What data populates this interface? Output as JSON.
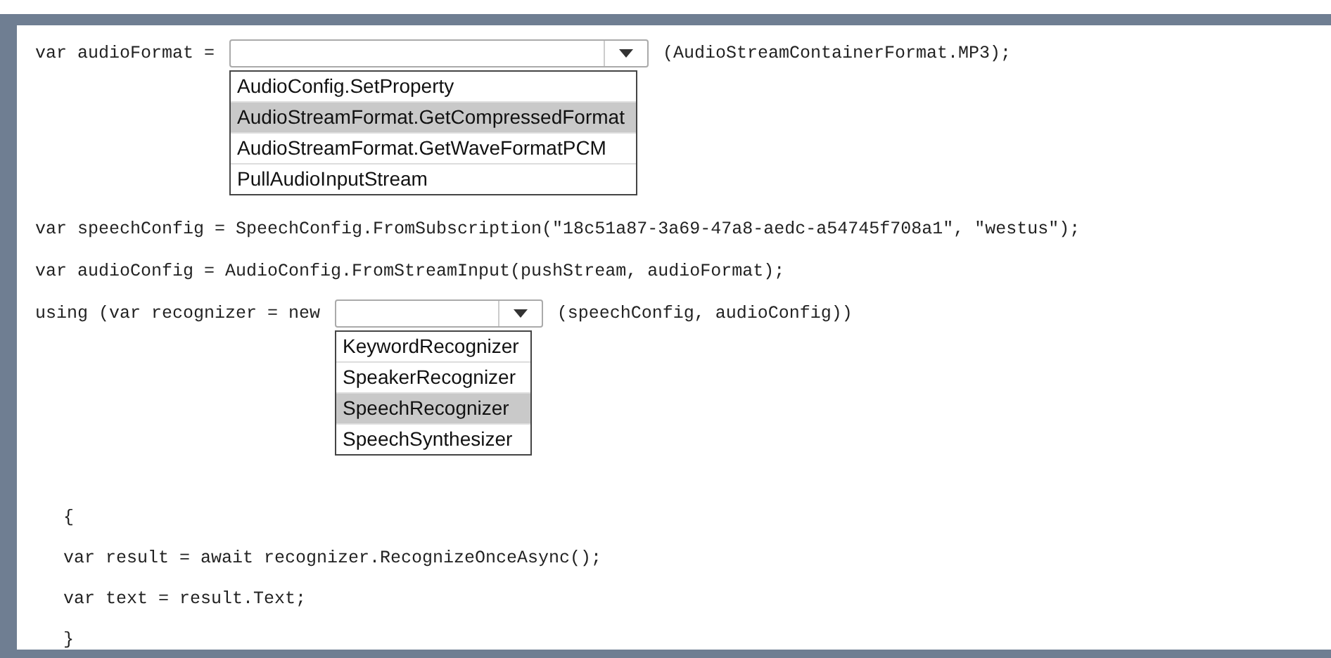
{
  "code_lines": [
    {
      "kind": "select",
      "before": "var audioFormat =",
      "after": "(AudioStreamContainerFormat.MP3);",
      "dropdown": {
        "options": [
          {
            "label": "AudioConfig.SetProperty",
            "selected": false
          },
          {
            "label": "AudioStreamFormat.GetCompressedFormat",
            "selected": true
          },
          {
            "label": "AudioStreamFormat.GetWaveFormatPCM",
            "selected": false
          },
          {
            "label": "PullAudioInputStream",
            "selected": false
          }
        ]
      }
    },
    {
      "kind": "text",
      "text": "var speechConfig = SpeechConfig.FromSubscription(\"18c51a87-3a69-47a8-aedc-a54745f708a1\", \"westus\");"
    },
    {
      "kind": "text",
      "text": "var audioConfig = AudioConfig.FromStreamInput(pushStream, audioFormat);"
    },
    {
      "kind": "select",
      "before": "using (var recognizer = new",
      "after": "(speechConfig, audioConfig))",
      "dropdown": {
        "options": [
          {
            "label": "KeywordRecognizer",
            "selected": false
          },
          {
            "label": "SpeakerRecognizer",
            "selected": false
          },
          {
            "label": "SpeechRecognizer",
            "selected": true
          },
          {
            "label": "SpeechSynthesizer",
            "selected": false
          }
        ]
      }
    }
  ],
  "using_body": [
    {
      "kind": "text",
      "text": "{"
    },
    {
      "kind": "text",
      "text": "var result = await recognizer.RecognizeOnceAsync();"
    },
    {
      "kind": "text",
      "text": "var text = result.Text;"
    },
    {
      "kind": "text",
      "text": "}"
    }
  ]
}
